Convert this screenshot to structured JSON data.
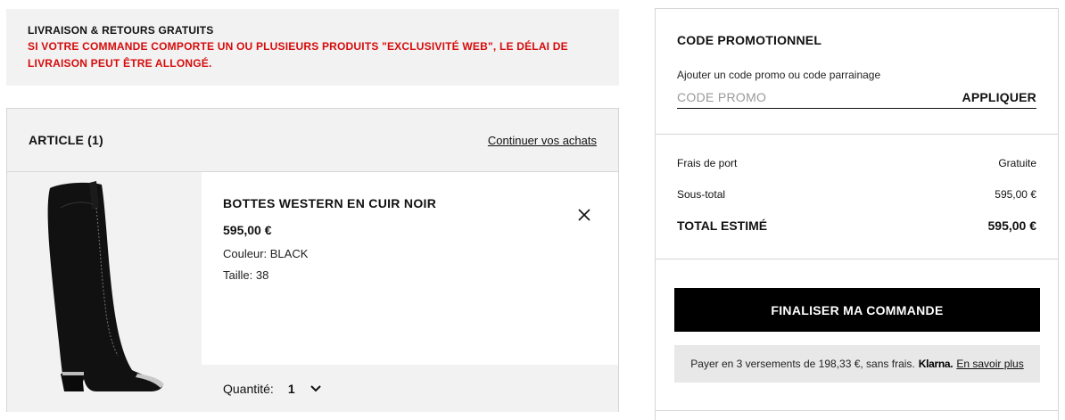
{
  "banner": {
    "title": "LIVRAISON & RETOURS GRATUITS",
    "warning_line1": "SI VOTRE COMMANDE COMPORTE UN OU PLUSIEURS PRODUITS \"EXCLUSIVITÉ WEB\", LE DÉLAI DE",
    "warning_line2": "LIVRAISON PEUT ÊTRE ALLONGÉ."
  },
  "cart": {
    "title": "ARTICLE (1)",
    "continue_label": "Continuer vos achats",
    "items": [
      {
        "name": "BOTTES WESTERN EN CUIR NOIR",
        "price": "595,00 €",
        "color": "Couleur: BLACK",
        "size": "Taille: 38",
        "quantity_label": "Quantité:",
        "quantity": "1",
        "image_icon": "black-western-boot"
      }
    ]
  },
  "promo": {
    "title": "CODE PROMOTIONNEL",
    "hint": "Ajouter un code promo ou code parrainage",
    "placeholder": "CODE PROMO",
    "apply_label": "APPLIQUER"
  },
  "summary": {
    "shipping_label": "Frais de port",
    "shipping_value": "Gratuite",
    "subtotal_label": "Sous-total",
    "subtotal_value": "595,00 €",
    "total_label": "TOTAL ESTIMÉ",
    "total_value": "595,00 €"
  },
  "checkout": {
    "button_label": "FINALISER MA COMMANDE",
    "klarna_text": "Payer en 3 versements de 198,33 €, sans frais.",
    "klarna_brand": "Klarna.",
    "klarna_more": "En savoir plus"
  },
  "colors": {
    "accent_red": "#d60b0b",
    "panel_gray": "#f2f2f2",
    "button_black": "#000000"
  }
}
